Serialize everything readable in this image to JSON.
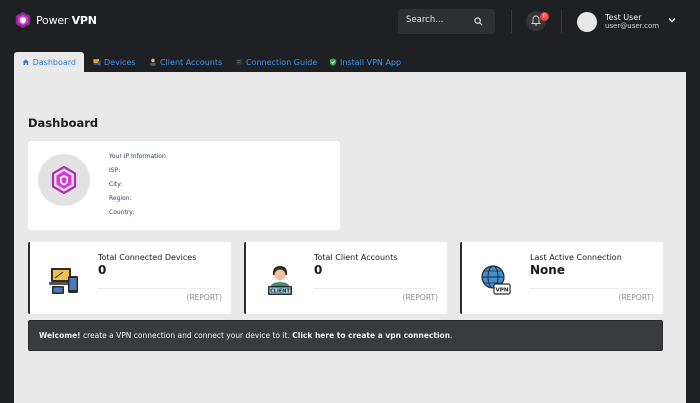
{
  "brand": {
    "prefix": "Power",
    "name": "VPN"
  },
  "search": {
    "placeholder": "Search..."
  },
  "notifications": {
    "count": "0"
  },
  "user": {
    "name": "Test User",
    "email": "user@user.com"
  },
  "tabs": [
    {
      "label": "Dashboard",
      "icon": "home-icon",
      "active": true
    },
    {
      "label": "Devices",
      "icon": "devices-icon"
    },
    {
      "label": "Client Accounts",
      "icon": "client-icon"
    },
    {
      "label": "Connection Guide",
      "icon": "guide-icon"
    },
    {
      "label": "Install VPN App",
      "icon": "shield-icon"
    }
  ],
  "page": {
    "title": "Dashboard"
  },
  "ip_info": {
    "heading": "Your IP Information",
    "isp": "ISP:",
    "city": "City:",
    "region": "Region:",
    "country": "Country:"
  },
  "stats": [
    {
      "title": "Total Connected Devices",
      "value": "0",
      "report": "(REPORT)",
      "icon": "devices-illustration-icon"
    },
    {
      "title": "Total Client Accounts",
      "value": "0",
      "report": "(REPORT)",
      "icon": "client-illustration-icon"
    },
    {
      "title": "Last Active Connection",
      "value": "None",
      "report": "(REPORT)",
      "icon": "vpn-globe-icon"
    }
  ],
  "banner": {
    "bold1": "Welcome!",
    "text": " create a VPN connection and connect your device to it. ",
    "link": "Click here to create a vpn connection",
    "end": "."
  },
  "colors": {
    "accent": "#3d96f5",
    "topbar": "#1f2023",
    "brand_icon": "#d63ad6",
    "badge": "#e8453c"
  }
}
